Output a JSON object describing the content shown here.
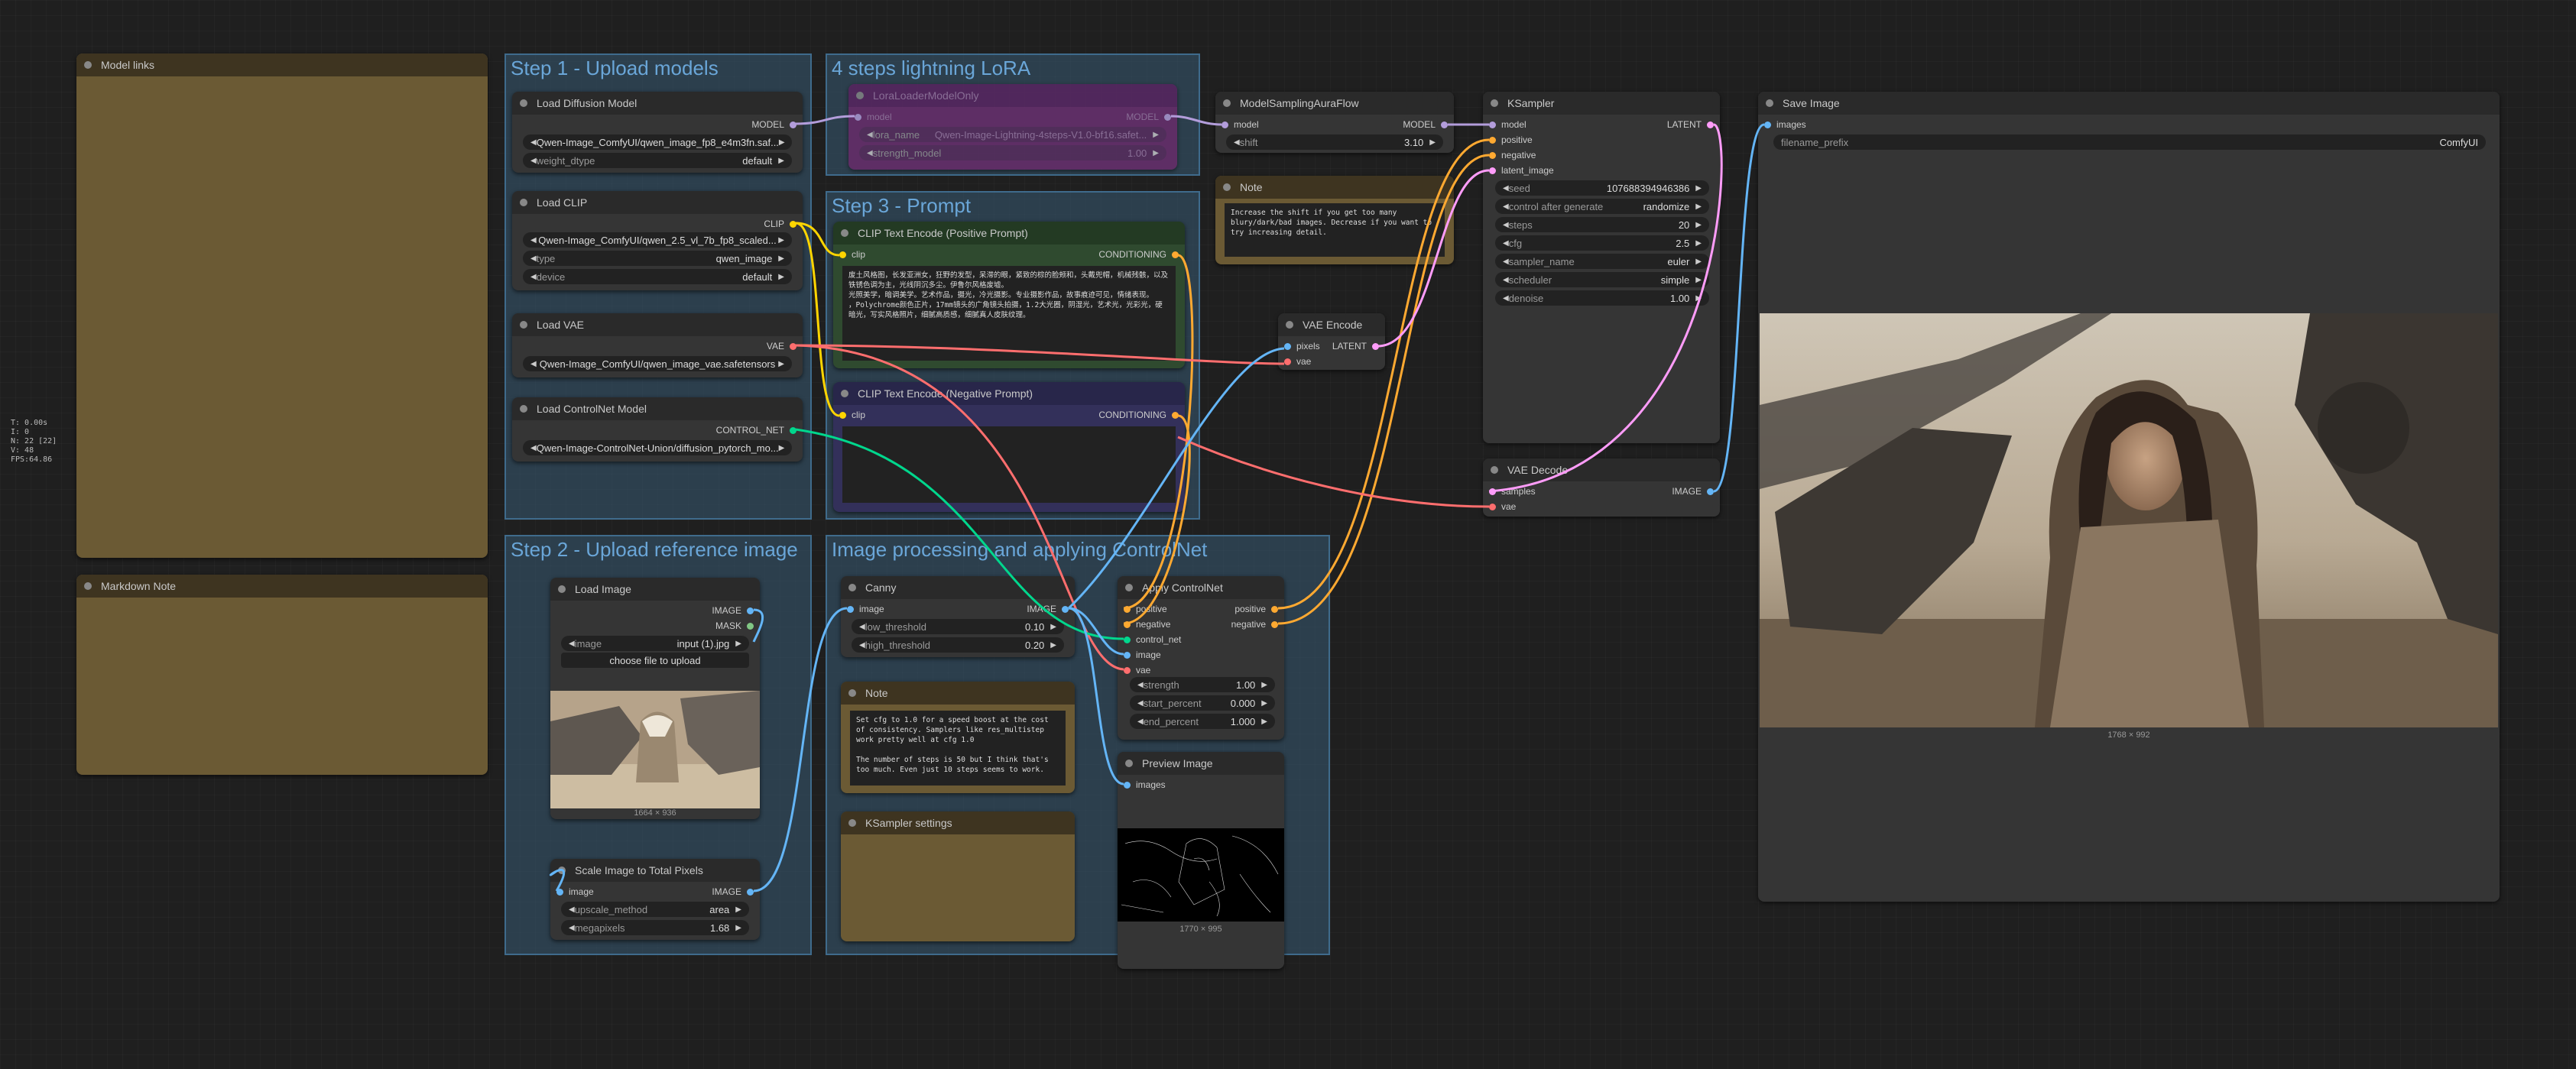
{
  "stats": [
    "T: 0.00s",
    "I: 0",
    "N: 22 [22]",
    "V: 48",
    "FPS:64.86"
  ],
  "groups": {
    "upload_models": "Step 1 - Upload models",
    "lora": "4 steps lightning LoRA",
    "prompt": "Step 3 - Prompt",
    "reference": "Step 2 - Upload reference image",
    "processing": "Image processing and applying ControlNet"
  },
  "notes": {
    "model_links": "Model links",
    "markdown_note": "Markdown Note",
    "note_shift": {
      "title": "Note",
      "text": "Increase the shift if you get too many blury/dark/bad images. Decrease if you want to try increasing detail."
    },
    "note_cfg": {
      "title": "Note",
      "text": "Set cfg to 1.0 for a speed boost at the cost of consistency. Samplers like res_multistep work pretty well at cfg 1.0\n\nThe number of steps is 50 but I think that's too much. Even just 10 steps seems to work."
    },
    "ksampler_settings": "KSampler settings"
  },
  "load_diffusion": {
    "title": "Load Diffusion Model",
    "out": "MODEL",
    "unet": "Qwen-Image_ComfyUI/qwen_image_fp8_e4m3fn.saf...",
    "dtype_label": "weight_dtype",
    "dtype": "default"
  },
  "load_clip": {
    "title": "Load CLIP",
    "out": "CLIP",
    "clip": "Qwen-Image_ComfyUI/qwen_2.5_vl_7b_fp8_scaled...",
    "type_label": "type",
    "type": "qwen_image",
    "device_label": "device",
    "device": "default"
  },
  "load_vae": {
    "title": "Load VAE",
    "out": "VAE",
    "vae": "Qwen-Image_ComfyUI/qwen_image_vae.safetensors"
  },
  "load_controlnet": {
    "title": "Load ControlNet Model",
    "out": "CONTROL_NET",
    "name": "Qwen-Image-ControlNet-Union/diffusion_pytorch_mo..."
  },
  "lora": {
    "title": "LoraLoaderModelOnly",
    "in": "model",
    "out": "MODEL",
    "name_label": "lora_name",
    "name": "Qwen-Image-Lightning-4steps-V1.0-bf16.safet...",
    "strength_label": "strength_model",
    "strength": "1.00"
  },
  "pos_prompt": {
    "title": "CLIP Text Encode (Positive Prompt)",
    "in": "clip",
    "out": "CONDITIONING",
    "text": "废土风格图，长发亚洲女，狂野的发型，呆滞的眼，紧致的棕的脸颊和，头戴兜帽，机械残骸，以及铁锈色调为主，光线阴沉多尘。伊鲁尔风格废墟。\n光照美学，暗调美学。艺术作品，摄光，冷光摄影。专业摄影作品，故事痕迹可见，情绪表现。\n，Polychrome颜色正片，17mm镜头的广角镜头拍摄，1.2大光圈，阴湿光，艺术光，光彩光，硬暗光，写实风格照片，细腻高质感，细腻真人皮肤纹理。"
  },
  "neg_prompt": {
    "title": "CLIP Text Encode (Negative Prompt)",
    "in": "clip",
    "out": "CONDITIONING",
    "text": ""
  },
  "model_sampling": {
    "title": "ModelSamplingAuraFlow",
    "in": "model",
    "out": "MODEL",
    "shift_label": "shift",
    "shift": "3.10"
  },
  "vae_encode": {
    "title": "VAE Encode",
    "in1": "pixels",
    "in2": "vae",
    "out": "LATENT"
  },
  "ksampler": {
    "title": "KSampler",
    "inputs": [
      "model",
      "positive",
      "negative",
      "latent_image"
    ],
    "out": "LATENT",
    "widgets": [
      [
        "seed",
        "1076883949463​86"
      ],
      [
        "control after generate",
        "randomize"
      ],
      [
        "steps",
        "20"
      ],
      [
        "cfg",
        "2.5"
      ],
      [
        "sampler_name",
        "euler"
      ],
      [
        "scheduler",
        "simple"
      ],
      [
        "denoise",
        "1.00"
      ]
    ]
  },
  "vae_decode": {
    "title": "VAE Decode",
    "in1": "samples",
    "in2": "vae",
    "out": "IMAGE"
  },
  "save_image": {
    "title": "Save Image",
    "in": "images",
    "prefix_label": "filename_prefix",
    "prefix": "ComfyUI",
    "size": "1768 × 992"
  },
  "load_image": {
    "title": "Load Image",
    "out1": "IMAGE",
    "out2": "MASK",
    "image_label": "image",
    "image": "input (1).jpg",
    "upload": "choose file to upload",
    "size": "1664 × 936"
  },
  "scale_image": {
    "title": "Scale Image to Total Pixels",
    "in": "image",
    "out": "IMAGE",
    "method_label": "upscale_method",
    "method": "area",
    "mp_label": "megapixels",
    "mp": "1.68"
  },
  "canny": {
    "title": "Canny",
    "in": "image",
    "out": "IMAGE",
    "low_label": "low_threshold",
    "low": "0.10",
    "high_label": "high_threshold",
    "high": "0.20"
  },
  "apply_cn": {
    "title": "Apply ControlNet",
    "inputs": [
      "positive",
      "negative",
      "control_net",
      "image",
      "vae"
    ],
    "out1": "positive",
    "out2": "negative",
    "widgets": [
      [
        "strength",
        "1.00"
      ],
      [
        "start_percent",
        "0.000"
      ],
      [
        "end_percent",
        "1.000"
      ]
    ]
  },
  "preview": {
    "title": "Preview Image",
    "in": "images",
    "size": "1770 × 995"
  },
  "colors": {
    "model": "#b39ddb",
    "clip": "#ffd500",
    "vae": "#ff6e6e",
    "cond": "#ffa931",
    "latent": "#ff9cf9",
    "image": "#64b5f6",
    "cn": "#00d78d"
  }
}
